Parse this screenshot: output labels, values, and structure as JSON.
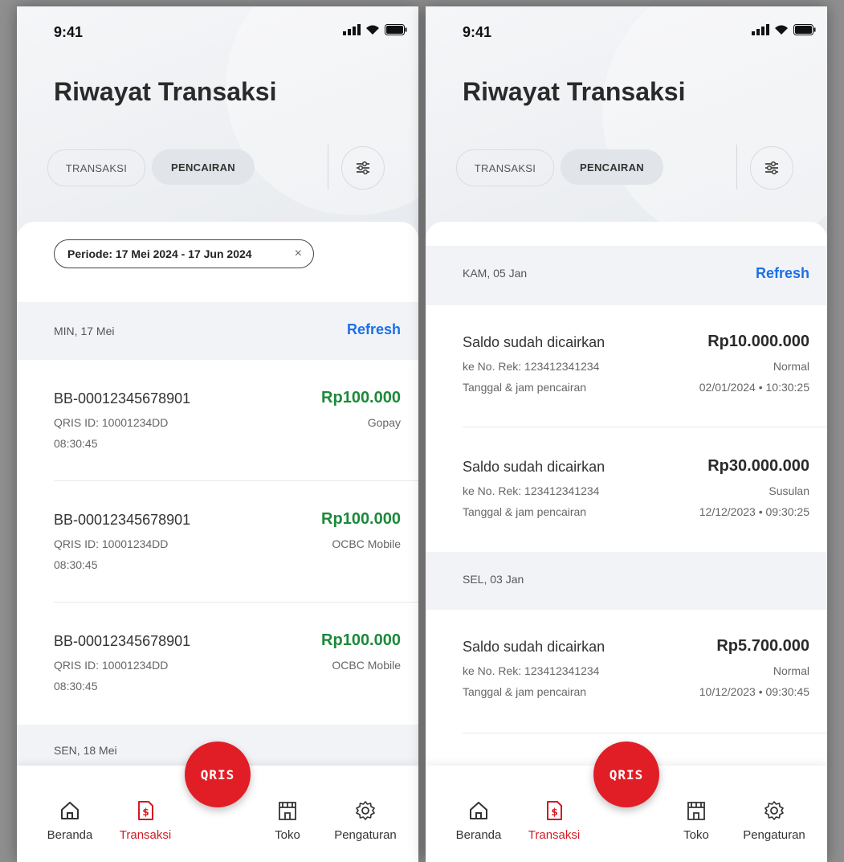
{
  "left": {
    "status_time": "9:41",
    "title": "Riwayat Transaksi",
    "tabs": [
      "TRANSAKSI",
      "PENCAIRAN"
    ],
    "period_chip": "Periode: 17 Mei 2024 - 17 Jun 2024",
    "chip_close": "×",
    "groups": [
      {
        "date": "MIN, 17 Mei",
        "refresh": "Refresh"
      }
    ],
    "rows": [
      {
        "id": "BB-00012345678901",
        "qris": "QRIS ID: 10001234DD",
        "time": "08:30:45",
        "amount": "Rp100.000",
        "method": "Gopay"
      },
      {
        "id": "BB-00012345678901",
        "qris": "QRIS ID: 10001234DD",
        "time": "08:30:45",
        "amount": "Rp100.000",
        "method": "OCBC Mobile"
      },
      {
        "id": "BB-00012345678901",
        "qris": "QRIS ID: 10001234DD",
        "time": "08:30:45",
        "amount": "Rp100.000",
        "method": "OCBC Mobile"
      }
    ],
    "next_date": "SEN, 18 Mei"
  },
  "right": {
    "status_time": "9:41",
    "title": "Riwayat Transaksi",
    "tabs": [
      "TRANSAKSI",
      "PENCAIRAN"
    ],
    "groups": [
      {
        "date": "KAM, 05 Jan",
        "refresh": "Refresh"
      },
      {
        "date": "SEL, 03 Jan"
      }
    ],
    "rows": [
      {
        "title": "Saldo sudah dicairkan",
        "account": "ke No. Rek: 123412341234",
        "label": "Tanggal & jam pencairan",
        "amount": "Rp10.000.000",
        "type": "Normal",
        "datetime": "02/01/2024 • 10:30:25"
      },
      {
        "title": "Saldo sudah dicairkan",
        "account": "ke No. Rek: 123412341234",
        "label": "Tanggal & jam pencairan",
        "amount": "Rp30.000.000",
        "type": "Susulan",
        "datetime": "12/12/2023 • 09:30:25"
      },
      {
        "title": "Saldo sudah dicairkan",
        "account": "ke No. Rek: 123412341234",
        "label": "Tanggal & jam pencairan",
        "amount": "Rp5.700.000",
        "type": "Normal",
        "datetime": "10/12/2023 • 09:30:45"
      }
    ]
  },
  "nav": {
    "items": [
      "Beranda",
      "Transaksi",
      "Toko",
      "Pengaturan"
    ],
    "active": "Transaksi",
    "qris_label": "QRIS"
  },
  "colors": {
    "accent_red": "#e11d26",
    "amount_green": "#1c8a3a",
    "link_blue": "#1d6fe8"
  },
  "icons": [
    "signal-icon",
    "wifi-icon",
    "battery-icon",
    "filter-sliders-icon",
    "home-icon",
    "receipt-icon",
    "store-icon",
    "gear-icon"
  ]
}
